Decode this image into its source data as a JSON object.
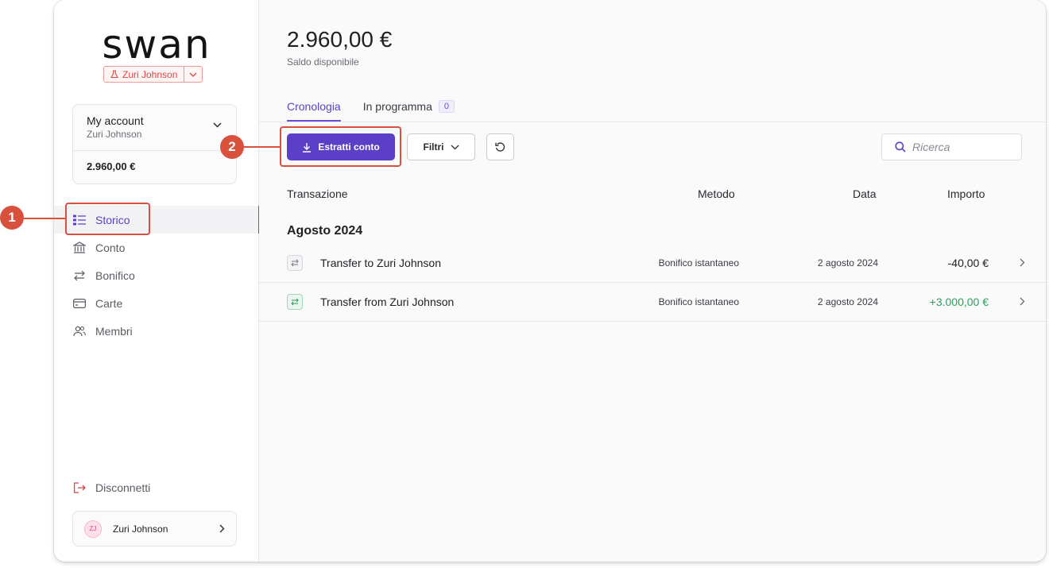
{
  "brand": {
    "logo_text": "swan"
  },
  "environment": {
    "user_name": "Zuri Johnson"
  },
  "account": {
    "name": "My account",
    "holder": "Zuri Johnson",
    "balance": "2.960,00 €"
  },
  "sidebar": {
    "items": [
      {
        "label": "Storico",
        "icon": "list-icon",
        "active": true
      },
      {
        "label": "Conto",
        "icon": "bank-icon",
        "active": false
      },
      {
        "label": "Bonifico",
        "icon": "transfer-icon",
        "active": false
      },
      {
        "label": "Carte",
        "icon": "card-icon",
        "active": false
      },
      {
        "label": "Membri",
        "icon": "members-icon",
        "active": false
      }
    ],
    "logout_label": "Disconnetti",
    "user": {
      "initials": "ZJ",
      "name": "Zuri Johnson"
    }
  },
  "main": {
    "balance": "2.960,00 €",
    "balance_label": "Saldo disponibile",
    "tabs": [
      {
        "label": "Cronologia",
        "active": true
      },
      {
        "label": "In programma",
        "count": "0",
        "active": false
      }
    ],
    "toolbar": {
      "statements_label": "Estratti conto",
      "filter_label": "Filtri",
      "search_placeholder": "Ricerca"
    },
    "table": {
      "headers": {
        "transaction": "Transazione",
        "method": "Metodo",
        "date": "Data",
        "amount": "Importo"
      },
      "group_label": "Agosto 2024",
      "rows": [
        {
          "label": "Transfer to Zuri Johnson",
          "method": "Bonifico istantaneo",
          "date": "2 agosto 2024",
          "amount": "-40,00 €",
          "direction": "outgoing"
        },
        {
          "label": "Transfer from Zuri Johnson",
          "method": "Bonifico istantaneo",
          "date": "2 agosto 2024",
          "amount": "+3.000,00 €",
          "direction": "incoming"
        }
      ]
    }
  },
  "annotations": [
    {
      "number": "1"
    },
    {
      "number": "2"
    }
  ],
  "colors": {
    "accent": "#5b3fc7",
    "callout": "#d9513d",
    "positive": "#2e9e5b",
    "env_badge": "#d84646"
  }
}
